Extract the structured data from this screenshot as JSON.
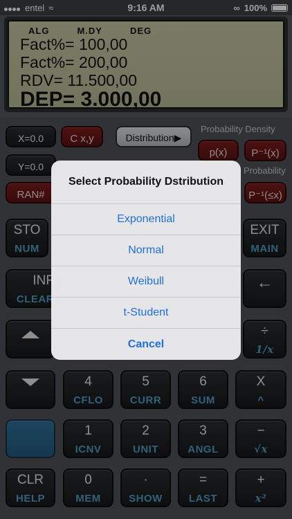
{
  "status_bar": {
    "carrier": "entel",
    "time": "9:16 AM",
    "battery": "100%"
  },
  "display": {
    "flags": [
      "ALG",
      "M.DY",
      "DEG"
    ],
    "lines": [
      "Fact%= 100,00",
      "Fact%= 200,00",
      "RDV= 11.500,00"
    ],
    "result": "DEP= 3.000,00"
  },
  "keys": {
    "x_reg": "X=0.0",
    "cxy": "C x,y",
    "y_reg": "Y=0.0",
    "ran": "RAN#",
    "distribution": "Distribution▶",
    "prob_density": "Probability Density",
    "prob": "Probability",
    "px": "p(x)",
    "pinv": "P⁻¹(x)",
    "pinvle": "P⁻¹(≤x)",
    "sto": "STO",
    "num": "NUM",
    "exit": "EXIT",
    "main": "MAIN",
    "inf": "INF",
    "clear": "CLEAR",
    "div": "÷",
    "recip": "1/x",
    "four": "4",
    "cflo": "CFLO",
    "five": "5",
    "curr": "CURR",
    "six": "6",
    "sum": "SUM",
    "mul": "X",
    "pow": "^",
    "one": "1",
    "icnv": "ICNV",
    "two": "2",
    "unit": "UNIT",
    "three": "3",
    "angl": "ANGL",
    "minus": "−",
    "sqrt": "√x",
    "clr": "CLR",
    "help": "HELP",
    "zero": "0",
    "mem": "MEM",
    "dot": "·",
    "show": "SHOW",
    "eq": "=",
    "last": "LAST",
    "plus": "+",
    "sq": "x²"
  },
  "dialog": {
    "title": "Select Probability Dstribution",
    "options": [
      "Exponential",
      "Normal",
      "Weibull",
      "t-Student"
    ],
    "cancel": "Cancel"
  },
  "colors": {
    "accent": "#1f6fdb",
    "lcd": "#c0c39e",
    "sublabel": "#4e9ec4",
    "red_key": "#6e1818"
  }
}
